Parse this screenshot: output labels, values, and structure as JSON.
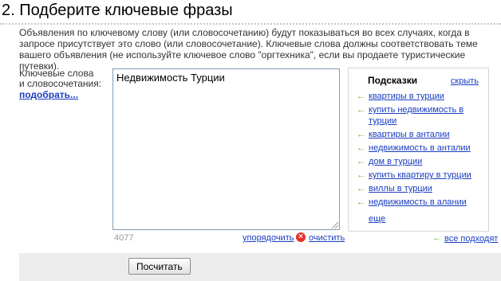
{
  "section": {
    "title": "2. Подберите ключевые фразы",
    "description": "Объявления по ключевому слову (или словосочетанию) будут показываться во всех случаях, когда в запросе присутствует это слово (или словосочетание). Ключевые слова должны соответствовать теме вашего объявления (не используйте ключевое слово \"оргтехника\", если вы продаете туристические путевки)."
  },
  "keywords": {
    "label_line1": "Ключевые слова",
    "label_line2": "и словосочетания:",
    "pick_link": "подобрать...",
    "value": "Недвижимость Турции",
    "counter": "4077",
    "sort_link": "упорядочить",
    "clear_link": "очистить",
    "clear_icon": "close-icon"
  },
  "hints": {
    "title": "Подсказки",
    "hide_link": "скрыть",
    "arrow_glyph": "←",
    "items": [
      "квартиры в турции",
      "купить недвижимость в турции",
      "квартиры в анталии",
      "недвижимость в анталии",
      "дом в турции",
      "купить квартиру в турции",
      "виллы в турции",
      "недвижимость в алании"
    ],
    "more_link": "еще",
    "all_link": "все подходят"
  },
  "footer": {
    "calc_button": "Посчитать"
  },
  "colors": {
    "link": "#1a3dc1",
    "arrow": "#64b62a",
    "clear_icon": "#e4322b",
    "footer_bg": "#ececec"
  }
}
